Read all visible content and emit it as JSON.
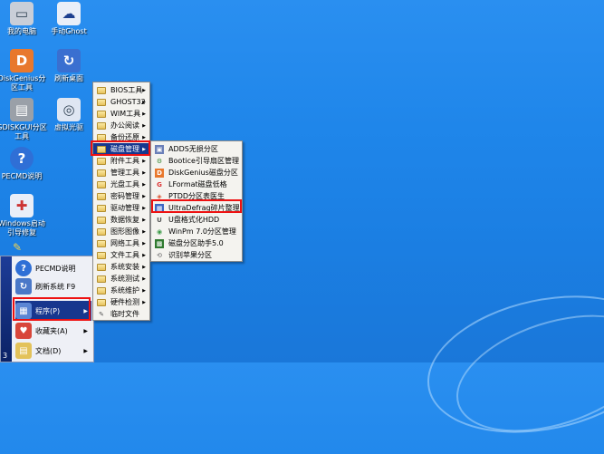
{
  "desktop_icons": [
    {
      "label": "我的电脑",
      "icon": "computer-icon",
      "color": "#c9ced8",
      "glyph": "▭"
    },
    {
      "label": "手动Ghost",
      "icon": "ghost-icon",
      "color": "#e9eef8",
      "glyph": "👻"
    },
    {
      "label": "DiskGenius分\n区工具",
      "icon": "diskgenius-icon",
      "color": "#e8782d",
      "glyph": "D"
    },
    {
      "label": "刷新桌面",
      "icon": "refresh-desktop-icon",
      "color": "#3a6fd0",
      "glyph": "↻"
    },
    {
      "label": "GDISKGUI分区\n工具",
      "icon": "gdisk-icon",
      "color": "#9aa0a8",
      "glyph": "▤"
    },
    {
      "label": "虚拟光驱",
      "icon": "virtual-drive-icon",
      "color": "#dfe6f2",
      "glyph": "◎"
    },
    {
      "label": "PECMD说明",
      "icon": "help-icon",
      "color": "#2f6fd6",
      "glyph": "?"
    },
    {
      "label": "Windows启动\n引导修复",
      "icon": "boot-repair-icon",
      "color": "#e9eef8",
      "glyph": "✚"
    }
  ],
  "start_menu": {
    "sidebar_text": "3",
    "items": [
      {
        "label": "PECMD说明",
        "icon": "help-icon",
        "color": "#2f6fd6",
        "glyph": "?",
        "arrow": ""
      },
      {
        "label": "刷新系统 F9",
        "icon": "refresh-icon",
        "color": "#4a78c8",
        "glyph": "↻",
        "arrow": ""
      },
      {
        "label": "程序(P)",
        "icon": "programs-icon",
        "color": "#5b86d4",
        "glyph": "▦",
        "arrow": "▶"
      },
      {
        "label": "收藏夹(A)",
        "icon": "favorites-icon",
        "color": "#d8463a",
        "glyph": "♥",
        "arrow": "▶"
      },
      {
        "label": "文档(D)",
        "icon": "documents-icon",
        "color": "#e3c25a",
        "glyph": "▤",
        "arrow": "▶"
      }
    ]
  },
  "programs_menu": {
    "items": [
      {
        "label": "BIOS工具",
        "arrow": "▶"
      },
      {
        "label": "GHOST32",
        "arrow": "▶"
      },
      {
        "label": "WIM工具",
        "arrow": "▶"
      },
      {
        "label": "办公阅读",
        "arrow": "▶"
      },
      {
        "label": "备份还原",
        "arrow": "▶"
      },
      {
        "label": "磁盘管理",
        "arrow": "▶"
      },
      {
        "label": "附件工具",
        "arrow": "▶"
      },
      {
        "label": "管理工具",
        "arrow": "▶"
      },
      {
        "label": "光盘工具",
        "arrow": "▶"
      },
      {
        "label": "密码管理",
        "arrow": "▶"
      },
      {
        "label": "驱动管理",
        "arrow": "▶"
      },
      {
        "label": "数据恢复",
        "arrow": "▶"
      },
      {
        "label": "图形图像",
        "arrow": "▶"
      },
      {
        "label": "网络工具",
        "arrow": "▶"
      },
      {
        "label": "文件工具",
        "arrow": "▶"
      },
      {
        "label": "系统安装",
        "arrow": "▶"
      },
      {
        "label": "系统测试",
        "arrow": "▶"
      },
      {
        "label": "系统维护",
        "arrow": "▶"
      },
      {
        "label": "硬件检测",
        "arrow": "▶"
      },
      {
        "label": "临时文件",
        "arrow": ""
      }
    ]
  },
  "disk_menu": {
    "items": [
      {
        "label": "ADDS无损分区",
        "icon": "adds-icon",
        "color": "#6a7fb8",
        "glyph": "▣"
      },
      {
        "label": "Bootice引导扇区管理",
        "icon": "bootice-icon",
        "color": "#3f8c3a",
        "glyph": "⚙"
      },
      {
        "label": "DiskGenius磁盘分区",
        "icon": "diskgenius-icon",
        "color": "#e8782d",
        "glyph": "D"
      },
      {
        "label": "LFormat磁盘低格",
        "icon": "lformat-icon",
        "color": "#d33",
        "glyph": "G"
      },
      {
        "label": "PTDD分区表医生",
        "icon": "ptdd-icon",
        "color": "#d7502c",
        "glyph": "◈"
      },
      {
        "label": "UltraDefrag碎片整理",
        "icon": "ultradefrag-icon",
        "color": "#3b66c4",
        "glyph": "▦"
      },
      {
        "label": "U盘格式化HDD",
        "icon": "usb-format-icon",
        "color": "#555",
        "glyph": "U"
      },
      {
        "label": "WinPm 7.0分区管理",
        "icon": "winpm-icon",
        "color": "#3b9a48",
        "glyph": "◉"
      },
      {
        "label": "磁盘分区助手5.0",
        "icon": "partition-assistant-icon",
        "color": "#2f7a2f",
        "glyph": "▩"
      },
      {
        "label": "识别苹果分区",
        "icon": "apple-partition-icon",
        "color": "#888",
        "glyph": "⟲"
      }
    ]
  }
}
